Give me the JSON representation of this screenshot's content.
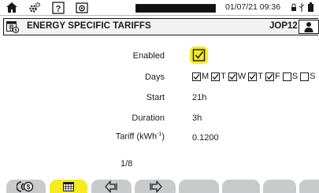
{
  "status_bar": {
    "icons": [
      "home-icon",
      "gear-icon",
      "help-icon",
      "camera-icon",
      "lock-icon",
      "usb-icon",
      "battery-icon"
    ],
    "progress": 1.0,
    "datetime": "01/07/21 09:36"
  },
  "header": {
    "icon": "tariff-calendar-icon",
    "title": "ENERGY SPECIFIC TARIFFS",
    "profile": "JOP12",
    "user_icon": "user-icon"
  },
  "form": {
    "enabled": {
      "label": "Enabled",
      "checked": true
    },
    "days": {
      "label": "Days",
      "items": [
        {
          "label": "M",
          "checked": true
        },
        {
          "label": "T",
          "checked": true
        },
        {
          "label": "W",
          "checked": true
        },
        {
          "label": "T",
          "checked": true
        },
        {
          "label": "F",
          "checked": true
        },
        {
          "label": "S",
          "checked": false
        },
        {
          "label": "S",
          "checked": false
        }
      ]
    },
    "start": {
      "label": "Start",
      "value": "21h"
    },
    "duration": {
      "label": "Duration",
      "value": "3h"
    },
    "tariff": {
      "label_main": "Tariff (kWh",
      "label_sup": "-1",
      "label_end": ")",
      "value": "0.1200"
    }
  },
  "pagination": {
    "text": "1/8"
  },
  "tabs": [
    {
      "icon": "energy-tariff-icon",
      "active": false
    },
    {
      "icon": "calendar-icon",
      "active": true
    },
    {
      "icon": "previous-page-icon",
      "active": false
    },
    {
      "icon": "next-page-icon",
      "active": false
    },
    {
      "icon": "",
      "active": false
    },
    {
      "icon": "",
      "active": false
    },
    {
      "icon": "",
      "active": false
    },
    {
      "icon": "",
      "active": false
    }
  ],
  "colors": {
    "accent": "#f5ec20",
    "tab": "#c9cacc",
    "text": "#1a1a1a"
  }
}
